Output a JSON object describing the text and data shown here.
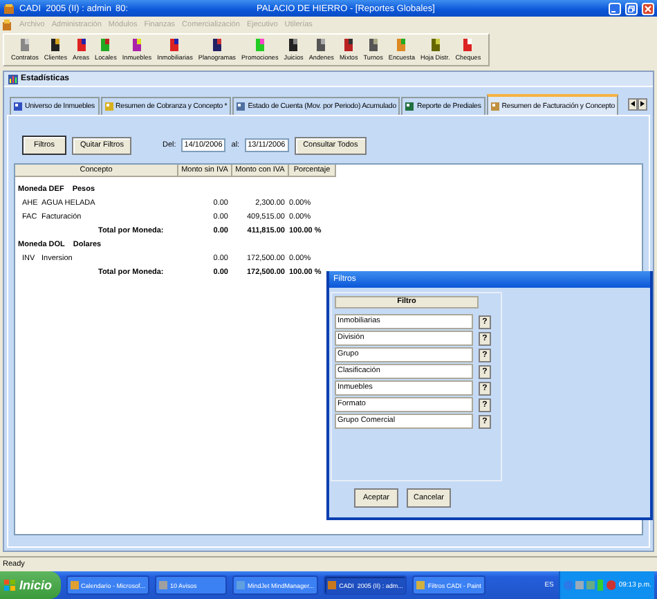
{
  "window": {
    "title": "CADI  2005 (II) : admin",
    "session": "80:",
    "document_title": "PALACIO DE HIERRO - [Reportes Globales]"
  },
  "menu": [
    {
      "label": "Archivo",
      "disabled": true
    },
    {
      "label": "Administración",
      "disabled": true
    },
    {
      "label": "Módulos",
      "disabled": true
    },
    {
      "label": "Finanzas",
      "disabled": true
    },
    {
      "label": "Comercialización",
      "disabled": true
    },
    {
      "label": "Ejecutivo",
      "disabled": true
    },
    {
      "label": "Utilerías",
      "disabled": true
    }
  ],
  "toolbar": [
    "Contratos",
    "Clientes",
    "Areas",
    "Locales",
    "Inmuebles",
    "Inmobiliarias",
    "Planogramas",
    "Promociones",
    "Juicios",
    "Andenes",
    "Mixtos",
    "Turnos",
    "Encuesta",
    "Hoja Distr.",
    "Cheques"
  ],
  "child_window": {
    "title": "Estadísticas"
  },
  "tabs": [
    {
      "label": "Universo de Inmuebles",
      "selected": false
    },
    {
      "label": "Resumen de Cobranza y Concepto *",
      "selected": false
    },
    {
      "label": "Estado de Cuenta (Mov. por Periodo) Acumulado",
      "selected": false
    },
    {
      "label": "Reporte de Prediales",
      "selected": false
    },
    {
      "label": "Resumen de Facturación y Concepto",
      "selected": true
    }
  ],
  "filters_bar": {
    "buttons": [
      "Filtros",
      "Quitar Filtros"
    ],
    "from_label": "Del:",
    "from": "14/10/2006",
    "to_label": "al:",
    "to": "13/11/2006",
    "consult": "Consultar Todos"
  },
  "table": {
    "columns": [
      "Concepto",
      "Monto sin IVA",
      "Monto con IVA",
      "Porcentaje"
    ],
    "groups": [
      {
        "currency": "Moneda DEF",
        "currency_name": "Pesos",
        "rows": [
          {
            "code": "AHE",
            "name": "AGUA HELADA",
            "without_tax": "0.00",
            "with_tax": "2,300.00",
            "percent": "0.00%"
          },
          {
            "code": "FAC",
            "name": "Facturación",
            "without_tax": "0.00",
            "with_tax": "409,515.00",
            "percent": "0.00%"
          }
        ],
        "total": {
          "label": "Total por Moneda:",
          "without_tax": "0.00",
          "with_tax": "411,815.00",
          "percent": "100.00 %"
        }
      },
      {
        "currency": "Moneda DOL",
        "currency_name": "Dolares",
        "rows": [
          {
            "code": "INV",
            "name": "Inversion",
            "without_tax": "0.00",
            "with_tax": "172,500.00",
            "percent": "0.00%"
          }
        ],
        "total": {
          "label": "Total por Moneda:",
          "without_tax": "0.00",
          "with_tax": "172,500.00",
          "percent": "100.00 %"
        }
      }
    ]
  },
  "dialog": {
    "title": "Filtros",
    "column": "Filtro",
    "filters": [
      {
        "label": "Inmobiliarias",
        "button": "?"
      },
      {
        "label": "División",
        "button": "?"
      },
      {
        "label": "Grupo",
        "button": "?"
      },
      {
        "label": "Clasificación",
        "button": "?"
      },
      {
        "label": "Inmuebles",
        "button": "?"
      },
      {
        "label": "Formato",
        "button": "?"
      },
      {
        "label": "Grupo Comercial",
        "button": "?"
      }
    ],
    "buttons": [
      "Aceptar",
      "Cancelar"
    ]
  },
  "status_bar": "Ready",
  "taskbar": {
    "start": "Inicio",
    "items": [
      {
        "label": "Calendario - Microsof...",
        "selected": false
      },
      {
        "label": "10 Avisos",
        "selected": false
      },
      {
        "label": "MindJet MindManager...",
        "selected": false
      },
      {
        "label": "CADI  2005 (II) : adm...",
        "selected": true
      },
      {
        "label": "Filtros CADI - Paint",
        "selected": false
      }
    ],
    "language": "ES",
    "clock": "09:13 p.m."
  }
}
